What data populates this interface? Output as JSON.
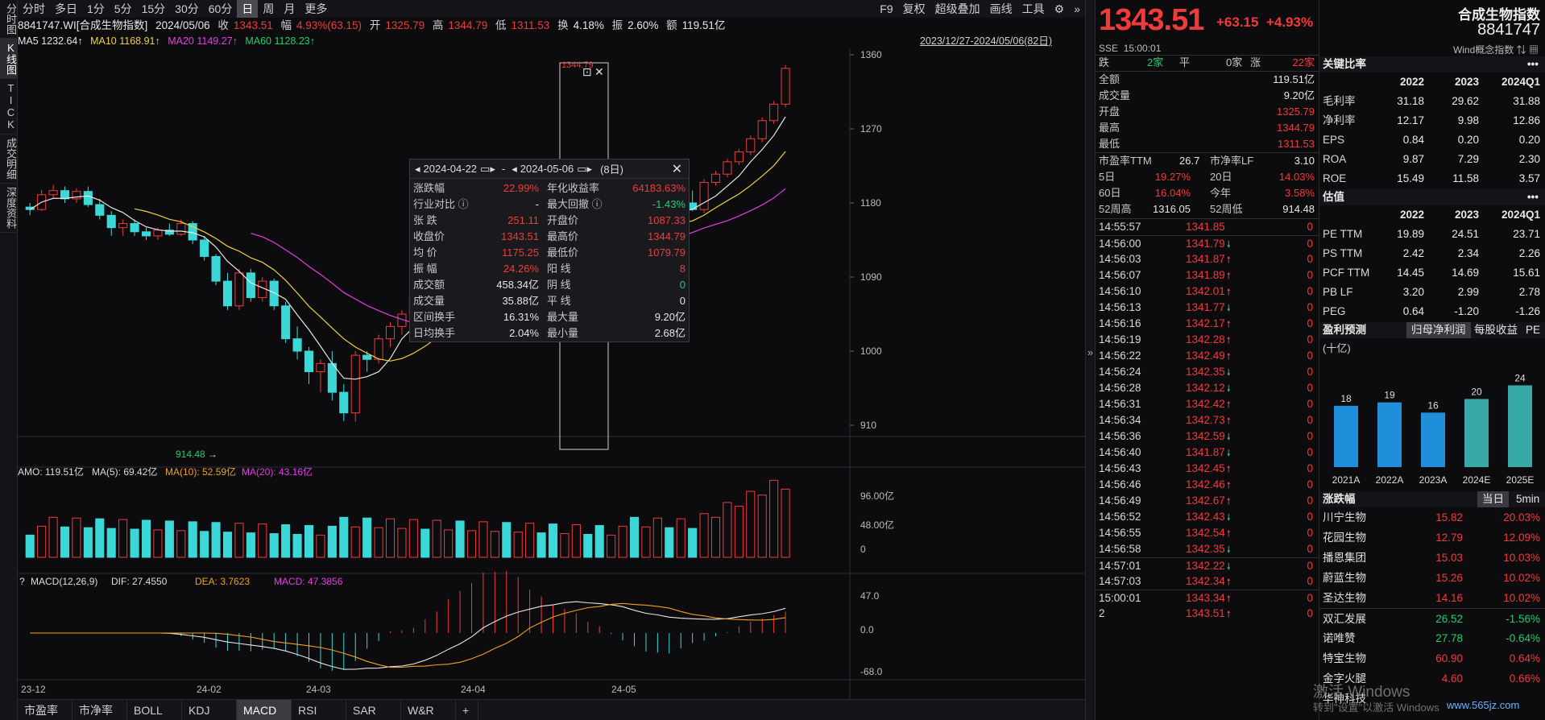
{
  "side_tabs": [
    "分时图",
    "K线图",
    "TICK",
    "成交明细",
    "深度资料"
  ],
  "toolbar": {
    "periods": [
      "分时",
      "多日",
      "1分",
      "5分",
      "15分",
      "30分",
      "60分",
      "日",
      "周",
      "月",
      "更多"
    ],
    "active": "日",
    "right": [
      "F9",
      "复权",
      "超级叠加",
      "画线",
      "工具"
    ]
  },
  "info": {
    "code": "8841747.WI[合成生物指数]",
    "date": "2024/05/06",
    "close_label": "收",
    "close": "1343.51",
    "pct": "4.93%(63.15)",
    "open_label": "开",
    "open": "1325.79",
    "high_label": "高",
    "high": "1344.79",
    "low_label": "低",
    "low": "1311.53",
    "turnover_label": "换",
    "turnover": "4.18%",
    "amp_label": "振",
    "amp": "2.60%",
    "amount_label": "额",
    "amount": "119.51亿",
    "amp_prefix": "幅"
  },
  "ma": {
    "ma5": "MA5 1232.64↑",
    "ma10": "MA10 1168.91↑",
    "ma20": "MA20 1149.27↑",
    "ma60": "MA60 1128.23↑",
    "range": "2023/12/27-2024/05/06(82日)"
  },
  "price_axis": [
    "1360",
    "1270",
    "1180",
    "1090",
    "1000",
    "910"
  ],
  "min_label": "914.48",
  "max_label": "1344.79",
  "amo": {
    "amo": "AMO: 119.51亿",
    "ma5": "MA(5): 69.42亿",
    "ma10": "MA(10): 52.59亿",
    "ma20": "MA(20): 43.16亿",
    "axis": [
      "96.00亿",
      "48.00亿",
      "0"
    ]
  },
  "macd": {
    "label": "MACD(12,26,9)",
    "dif": "DIF: 27.4550",
    "dea": "DEA: 3.7623",
    "macd": "MACD: 47.3856",
    "axis": [
      "47.0",
      "0.0",
      "-68.0"
    ]
  },
  "date_axis": [
    "23-12",
    "24-02",
    "24-03",
    "24-04",
    "24-05"
  ],
  "popup": {
    "start": "2024-04-22",
    "end": "2024-05-06",
    "days": "(8日)",
    "rows": [
      [
        "涨跌幅",
        "22.99%",
        "年化收益率",
        "64183.63%"
      ],
      [
        "行业对比 ⓘ",
        "-",
        "最大回撤 ⓘ",
        "-1.43%"
      ],
      [
        "张  跌",
        "251.11",
        "开盘价",
        "1087.33"
      ],
      [
        "收盘价",
        "1343.51",
        "最高价",
        "1344.79"
      ],
      [
        "均  价",
        "1175.25",
        "最低价",
        "1079.79"
      ],
      [
        "振  幅",
        "24.26%",
        "阳  线",
        "8"
      ],
      [
        "成交额",
        "458.34亿",
        "阴  线",
        "0"
      ],
      [
        "成交量",
        "35.88亿",
        "平  线",
        "0"
      ],
      [
        "区间换手",
        "16.31%",
        "最大量",
        "9.20亿"
      ],
      [
        "日均换手",
        "2.04%",
        "最小量",
        "2.68亿"
      ]
    ]
  },
  "bottom_tabs": [
    "市盈率",
    "市净率",
    "BOLL",
    "KDJ",
    "MACD",
    "RSI",
    "SAR",
    "W&R",
    "+"
  ],
  "quote": {
    "price": "1343.51",
    "chg": "+63.15",
    "pct": "+4.93%",
    "exchange": "SSE",
    "time": "15:00:01",
    "breadth": {
      "down_label": "跌",
      "down": "2家",
      "flat_label": "平",
      "flat": "0家",
      "up_label": "涨",
      "up": "22家"
    },
    "stats": [
      [
        "全额",
        "119.51亿"
      ],
      [
        "成交量",
        "9.20亿"
      ],
      [
        "开盘",
        "1325.79"
      ],
      [
        "最高",
        "1344.79"
      ],
      [
        "最低",
        "1311.53"
      ]
    ],
    "pe": {
      "pe_label": "市盈率TTM",
      "pe": "26.7",
      "pb_label": "市净率LF",
      "pb": "3.10"
    },
    "perf": [
      [
        "5日",
        "19.27%",
        "20日",
        "14.03%"
      ],
      [
        "60日",
        "16.04%",
        "今年",
        "3.58%"
      ],
      [
        "52周高",
        "1316.05",
        "52周低",
        "914.48"
      ]
    ],
    "ticks": [
      [
        "14:55:57",
        "1341.85",
        "",
        "0"
      ],
      [
        "14:56:00",
        "1341.79",
        "down",
        "0"
      ],
      [
        "14:56:03",
        "1341.87",
        "up",
        "0"
      ],
      [
        "14:56:07",
        "1341.89",
        "up",
        "0"
      ],
      [
        "14:56:10",
        "1342.01",
        "up",
        "0"
      ],
      [
        "14:56:13",
        "1341.77",
        "down",
        "0"
      ],
      [
        "14:56:16",
        "1342.17",
        "up",
        "0"
      ],
      [
        "14:56:19",
        "1342.28",
        "up",
        "0"
      ],
      [
        "14:56:22",
        "1342.49",
        "up",
        "0"
      ],
      [
        "14:56:24",
        "1342.35",
        "down",
        "0"
      ],
      [
        "14:56:28",
        "1342.12",
        "down",
        "0"
      ],
      [
        "14:56:31",
        "1342.42",
        "up",
        "0"
      ],
      [
        "14:56:34",
        "1342.73",
        "up",
        "0"
      ],
      [
        "14:56:36",
        "1342.59",
        "down",
        "0"
      ],
      [
        "14:56:40",
        "1341.87",
        "down",
        "0"
      ],
      [
        "14:56:43",
        "1342.45",
        "up",
        "0"
      ],
      [
        "14:56:46",
        "1342.46",
        "up",
        "0"
      ],
      [
        "14:56:49",
        "1342.67",
        "up",
        "0"
      ],
      [
        "14:56:52",
        "1342.43",
        "down",
        "0"
      ],
      [
        "14:56:55",
        "1342.54",
        "up",
        "0"
      ],
      [
        "14:56:58",
        "1342.35",
        "down",
        "0"
      ],
      [
        "14:57:01",
        "1342.22",
        "down",
        "0"
      ],
      [
        "14:57:03",
        "1342.34",
        "up",
        "0"
      ],
      [
        "15:00:01",
        "1343.34",
        "up",
        "0"
      ],
      [
        "2",
        "1343.51",
        "up",
        "0"
      ]
    ]
  },
  "fund": {
    "name": "合成生物指数",
    "code": "8841747",
    "sub": "Wind概念指数",
    "key_ratio": {
      "title": "关键比率",
      "cols": [
        "2022",
        "2023",
        "2024Q1"
      ],
      "rows": [
        [
          "毛利率",
          "31.18",
          "29.62",
          "31.88"
        ],
        [
          "净利率",
          "12.17",
          "9.98",
          "12.86"
        ],
        [
          "EPS",
          "0.84",
          "0.20",
          "0.20"
        ],
        [
          "ROA",
          "9.87",
          "7.29",
          "2.30"
        ],
        [
          "ROE",
          "15.49",
          "11.58",
          "3.57"
        ]
      ]
    },
    "valuation": {
      "title": "估值",
      "cols": [
        "2022",
        "2023",
        "2024Q1"
      ],
      "rows": [
        [
          "PE TTM",
          "19.89",
          "24.51",
          "23.71"
        ],
        [
          "PS TTM",
          "2.42",
          "2.34",
          "2.26"
        ],
        [
          "PCF TTM",
          "14.45",
          "14.69",
          "15.61"
        ],
        [
          "PB LF",
          "3.20",
          "2.99",
          "2.78"
        ],
        [
          "PEG",
          "0.64",
          "-1.20",
          "-1.26"
        ]
      ]
    },
    "forecast": {
      "title": "盈利预测",
      "tabs": [
        "归母净利润",
        "每股收益",
        "PE"
      ],
      "unit": "(十亿)",
      "chart_data": {
        "type": "bar",
        "categories": [
          "2021A",
          "2022A",
          "2023A",
          "2024E",
          "2025E"
        ],
        "values": [
          18,
          19,
          16,
          20,
          24
        ]
      }
    },
    "movers": {
      "title": "涨跌幅",
      "tabs": [
        "当日",
        "5min"
      ],
      "rows": [
        [
          "川宁生物",
          "15.82",
          "20.03%",
          "up"
        ],
        [
          "花园生物",
          "12.79",
          "12.09%",
          "up"
        ],
        [
          "播恩集团",
          "15.03",
          "10.03%",
          "up"
        ],
        [
          "蔚蓝生物",
          "15.26",
          "10.02%",
          "up"
        ],
        [
          "圣达生物",
          "14.16",
          "10.02%",
          "up"
        ],
        [
          "双汇发展",
          "26.52",
          "-1.56%",
          "down"
        ],
        [
          "诺唯赞",
          "27.78",
          "-0.64%",
          "down"
        ],
        [
          "特宝生物",
          "60.90",
          "0.64%",
          "up"
        ],
        [
          "金字火腿",
          "4.60",
          "0.66%",
          "up"
        ],
        [
          "华神科技",
          "",
          "",
          ""
        ]
      ]
    }
  },
  "watermark": {
    "line1": "激活 Windows",
    "line2": "转到\"设置\"以激活 Windows",
    "site": "www.565jz.com"
  },
  "chart_data": {
    "type": "candlestick",
    "title": "8841747.WI[合成生物指数]",
    "x_range": [
      "2023/12/27",
      "2024/05/06"
    ],
    "ylim": [
      910,
      1360
    ],
    "candles_ohlc": [
      [
        1175,
        1180,
        1165,
        1172
      ],
      [
        1172,
        1196,
        1170,
        1190
      ],
      [
        1190,
        1202,
        1185,
        1195
      ],
      [
        1195,
        1200,
        1180,
        1185
      ],
      [
        1185,
        1198,
        1180,
        1194
      ],
      [
        1194,
        1200,
        1175,
        1178
      ],
      [
        1178,
        1185,
        1160,
        1165
      ],
      [
        1165,
        1170,
        1140,
        1150
      ],
      [
        1150,
        1160,
        1140,
        1155
      ],
      [
        1155,
        1160,
        1140,
        1145
      ],
      [
        1145,
        1150,
        1135,
        1140
      ],
      [
        1140,
        1150,
        1135,
        1147
      ],
      [
        1147,
        1155,
        1140,
        1142
      ],
      [
        1142,
        1160,
        1140,
        1155
      ],
      [
        1155,
        1158,
        1130,
        1135
      ],
      [
        1135,
        1140,
        1110,
        1115
      ],
      [
        1115,
        1118,
        1080,
        1085
      ],
      [
        1085,
        1095,
        1050,
        1055
      ],
      [
        1055,
        1100,
        1050,
        1095
      ],
      [
        1095,
        1100,
        1060,
        1065
      ],
      [
        1065,
        1090,
        1060,
        1085
      ],
      [
        1085,
        1088,
        1050,
        1055
      ],
      [
        1055,
        1060,
        1010,
        1015
      ],
      [
        1015,
        1030,
        990,
        1000
      ],
      [
        1000,
        1005,
        960,
        975
      ],
      [
        975,
        990,
        950,
        985
      ],
      [
        985,
        1000,
        940,
        950
      ],
      [
        950,
        960,
        915,
        925
      ],
      [
        925,
        1000,
        914.48,
        995
      ],
      [
        995,
        1000,
        975,
        990
      ],
      [
        990,
        1020,
        985,
        1015
      ],
      [
        1015,
        1035,
        1005,
        1030
      ],
      [
        1030,
        1050,
        1020,
        1045
      ],
      [
        1045,
        1070,
        1040,
        1065
      ],
      [
        1065,
        1080,
        1055,
        1060
      ],
      [
        1060,
        1090,
        1055,
        1085
      ],
      [
        1085,
        1110,
        1080,
        1105
      ],
      [
        1105,
        1120,
        1080,
        1085
      ],
      [
        1085,
        1100,
        1075,
        1095
      ],
      [
        1095,
        1130,
        1090,
        1125
      ],
      [
        1125,
        1150,
        1115,
        1145
      ],
      [
        1145,
        1155,
        1120,
        1125
      ],
      [
        1125,
        1135,
        1115,
        1130
      ],
      [
        1130,
        1145,
        1120,
        1140
      ],
      [
        1140,
        1148,
        1125,
        1130
      ],
      [
        1130,
        1140,
        1115,
        1120
      ],
      [
        1120,
        1145,
        1115,
        1140
      ],
      [
        1140,
        1155,
        1135,
        1150
      ],
      [
        1150,
        1160,
        1130,
        1135
      ],
      [
        1135,
        1140,
        1115,
        1125
      ],
      [
        1125,
        1150,
        1120,
        1145
      ],
      [
        1145,
        1165,
        1140,
        1160
      ],
      [
        1160,
        1172,
        1150,
        1155
      ],
      [
        1155,
        1170,
        1150,
        1165
      ],
      [
        1165,
        1180,
        1160,
        1175
      ],
      [
        1175,
        1188,
        1165,
        1170
      ],
      [
        1170,
        1185,
        1165,
        1180
      ],
      [
        1180,
        1195,
        1170,
        1172
      ]
    ],
    "tail_closes": [
      1205,
      1215,
      1230,
      1242,
      1258,
      1280,
      1300,
      1343.51
    ]
  }
}
